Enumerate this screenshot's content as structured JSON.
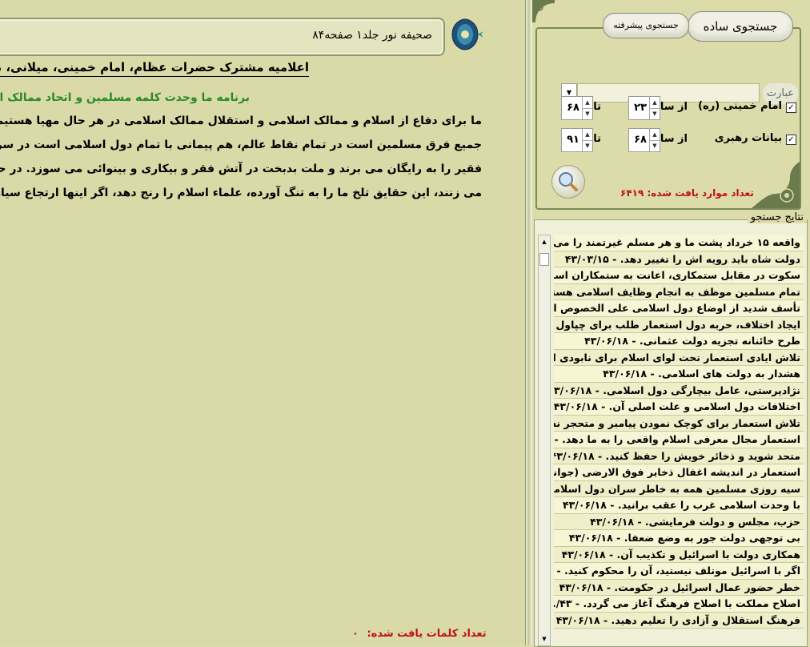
{
  "document": {
    "header": "صحیفه نور جلد۱ صفحه۸۴",
    "title": "اعلامیه مشترک حضرات عظام، امام خمینی، میلانی، نجفی مر",
    "subtitle": "برنامه ما وحدت کلمه مسلمین و اتحاد ممالک اسلا",
    "lines": [
      "ما برای دفاع از اسلام و ممالک اسلامی و استقلال ممالک اسلامی در هر حال مهیا هستیم. برنامه ما ک",
      "جمیع فرق مسلمین است در تمام نقاط عالم، هم پیمانی با تمام دول اسلامی است در سراسر جهان مقا",
      "فقیر را به رایگان می برند و ملت بدبخت در آتش فقر و بیکاری و بینوائی می سوزد. در حضور جهره ه",
      "می زنند، این حقایق تلخ ما را به تنگ آورده، علماء اسلام را رنج دهد، اگر اینها ارتجاع سیاه است، بگ"
    ],
    "found_words_label": "تعداد کلمات یافت شده:",
    "found_words_value": "۰"
  },
  "search": {
    "tab_simple": "جستجوی ساده",
    "tab_advanced": "جستجوی پیشرفته",
    "phrase_label": "عبارت",
    "phrase_value": "",
    "filters": [
      {
        "checked": true,
        "label": "امام خمینی (ره)",
        "from_label": "از سال:",
        "from_value": "۲۳",
        "to_label": "تا سال:",
        "to_value": "۶۸"
      },
      {
        "checked": true,
        "label": "بیانات رهبری",
        "from_label": "از سال:",
        "from_value": "۶۸",
        "to_label": "تا سال:",
        "to_value": "۹۱"
      }
    ],
    "found_count_label": "تعداد موارد یافت شده:",
    "found_count_value": "۶۴۱۹"
  },
  "results": {
    "title": "نتایج جستجو",
    "items": [
      "واقعه ۱۵ خرداد پشت ما و هر مسلم غیرتمند را می ...",
      "دولت شاه باید رویه اش را تغییر دهد. - ۴۳/۰۳/۱۵",
      "سکوت در مقابل ستمکاری، اعانت به ستمکاران است. ...",
      "تمام مسلمین موظف به انجام وظایف اسلامی هستند. ...",
      "تأسف شدید از اوضاع دول اسلامی علی الخصوص ایرا...",
      "ایجاد اختلاف، حربه دول استعمار طلب برای چپاول ذخا...",
      "طرح خائنانه تجزیه دولت عثمانی. - ۴۳/۰۶/۱۸",
      "تلاش ایادی استعمار تحت لوای اسلام برای نابودی ا...",
      "هشدار به دولت های اسلامی. - ۴۳/۰۶/۱۸",
      "نژادپرستی، عامل بیچارگی دول اسلامی. - ۴۳/۰۶/۱۸",
      "اختلافات دول اسلامی و علت اصلی آن. - ۴۳/۰۶/۱۸",
      "تلاش استعمار برای کوچک نمودن پیامبر و متحجر نشا...",
      "استعمار مجال معرفی اسلام واقعی را به ما دهد. - ۴۳...",
      "متحد شوید و ذخائر خویش را حفظ کنید. - ۴۳/۰۶/۱۸",
      "استعمار در اندیشه اغفال ذخایر فوق الارضی (جوانان)...",
      "سیه روزی مسلمین همه به خاطر سران دول اسلامی ...",
      "با وحدت اسلامی غرب را عقب برانید. - ۴۳/۰۶/۱۸",
      "حزب، مجلس و دولت فرمایشی. - ۴۳/۰۶/۱۸",
      "بی توجهی دولت جور به وضع ضعفا. - ۴۳/۰۶/۱۸",
      "همکاری دولت با اسرائیل و تکذیب آن. - ۴۳/۰۶/۱۸",
      "اگر با اسرائیل موتلف نیستید، آن را محکوم کنید. - ۴...",
      "خطر حضور عمال اسرائیل در حکومت. - ۴۳/۰۶/۱۸",
      "اصلاح مملکت با اصلاح فرهنگ آغاز می گردد. - ۴۳/...",
      "فرهنگ استقلال و آزادی را تعلیم دهید. - ۴۳/۰۶/۱۸"
    ]
  }
}
